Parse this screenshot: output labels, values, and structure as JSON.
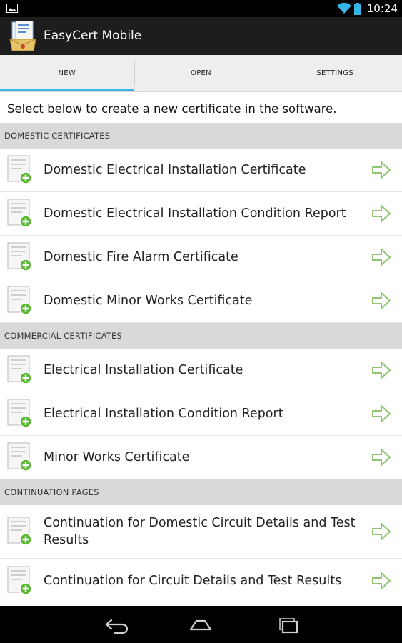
{
  "status_bar": {
    "time": "10:24",
    "left_icon": "picture-notification-icon",
    "wifi_icon": "wifi-icon",
    "battery_icon": "battery-icon"
  },
  "action_bar": {
    "app_icon": "easycert-app-icon",
    "title": "EasyCert Mobile"
  },
  "tabs": [
    {
      "label": "NEW",
      "active": true
    },
    {
      "label": "OPEN",
      "active": false
    },
    {
      "label": "SETTINGS",
      "active": false
    }
  ],
  "intro": "Select below to create a new certificate in the software.",
  "sections": [
    {
      "title": "DOMESTIC CERTIFICATES",
      "items": [
        "Domestic Electrical Installation Certificate",
        "Domestic Electrical Installation Condition Report",
        "Domestic Fire Alarm Certificate",
        "Domestic Minor Works Certificate"
      ]
    },
    {
      "title": "COMMERCIAL CERTIFICATES",
      "items": [
        "Electrical Installation Certificate",
        "Electrical Installation Condition Report",
        "Minor Works Certificate"
      ]
    },
    {
      "title": "CONTINUATION PAGES",
      "items": [
        "Continuation for Domestic Circuit Details and Test Results",
        "Continuation for Circuit Details and Test Results"
      ]
    }
  ],
  "item_icon": "add-document-icon",
  "item_arrow_icon": "arrow-right-icon",
  "colors": {
    "accent": "#33b5e5",
    "plus_green": "#5bb834",
    "arrow_green": "#8fc470",
    "section_header_bg": "#d9d9d9"
  },
  "nav": {
    "back_icon": "back-icon",
    "home_icon": "home-icon",
    "recent_icon": "recent-apps-icon"
  }
}
